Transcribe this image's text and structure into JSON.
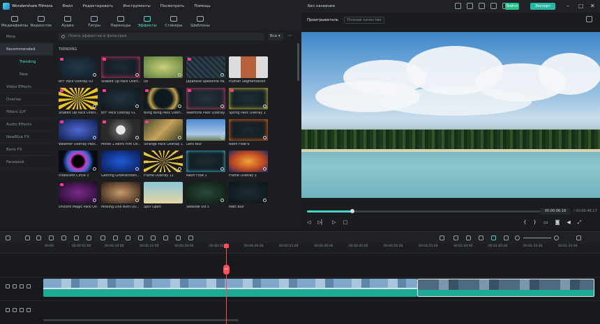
{
  "app": {
    "name": "Wondershare Filmora",
    "project_title": "Без названия"
  },
  "menu": [
    "Файл",
    "Редактировать",
    "Инструменты",
    "Посмотреть",
    "Помощь"
  ],
  "header_buttons": {
    "login": "Войти",
    "export": "Экспорт"
  },
  "toolbar_tabs": [
    {
      "label": "Медиафайлы",
      "icon": "media-icon"
    },
    {
      "label": "Видеосток",
      "icon": "stock-icon"
    },
    {
      "label": "Аудио",
      "icon": "music-icon"
    },
    {
      "label": "Титры",
      "icon": "text-icon"
    },
    {
      "label": "Переходы",
      "icon": "transition-icon"
    },
    {
      "label": "Эффекты",
      "icon": "effects-icon",
      "active": true
    },
    {
      "label": "Стикеры",
      "icon": "sticker-icon"
    },
    {
      "label": "Шаблоны",
      "icon": "template-icon"
    }
  ],
  "sidebar": {
    "items": [
      "Mine",
      "Recommended",
      "Trending",
      "New",
      "Video Effects",
      "Overlay",
      "Filters LUT",
      "Audio Effects",
      "NewBlue FX",
      "Boris FX",
      "Facebook"
    ],
    "active": "Trending"
  },
  "search": {
    "placeholder": "Поиск эффектов и фильтров",
    "filter": "Все"
  },
  "section_label": "TRENDING",
  "effects": [
    "BFF Pack Overlay 03",
    "Shakeit Up Pack Overl...",
    "08",
    "Japanese Speedline Pa...",
    "Human Segmentation",
    "Shakeit Up Pack Overl...",
    "BFF Pack Overlay 01",
    "Bling Bling Pack Overl...",
    "Valentine Pack Overlay...",
    "Spring Pack Overlay 1",
    "Weather Overlay Pack...",
    "Movie 1 Retro Film Ov...",
    "Strange Pack Overlay 1",
    "Lens Blur",
    "Neon Flow 6",
    "Iridescent Circle 3",
    "Gaming Greenscreen...",
    "Frame Overlay 11",
    "Neon Flow 1",
    "Frame Overlay 3",
    "Unicorn Magic Pack Ov...",
    "Missing Line With Ov...",
    "Spin Open",
    "Swallow Vlo 5",
    "Matt Blur"
  ],
  "preview": {
    "tab_player": "Проигрыватель",
    "quality": "Полное качество",
    "current_time": "00:00:06:18",
    "total_time": "00:00:48:17"
  },
  "ruler": [
    "00:00",
    "00:00:05:00",
    "00:00:10:00",
    "00:00:15:00",
    "00:00:20:00",
    "00:00:25:00",
    "00:00:30:00",
    "00:00:35:00",
    "00:00:40:00",
    "00:00:45:00",
    "00:00:50:00",
    "00:00:55:00",
    "00:01:00:00",
    "00:01:05:00",
    "00:01:10:00",
    "00:01:15:00",
    "00:01:20:00",
    "00:01:25:00",
    "00:01:30:00"
  ],
  "colors": {
    "accent": "#3fd8c7",
    "playhead": "#ff4d5a",
    "clip": "#1eaa92"
  }
}
